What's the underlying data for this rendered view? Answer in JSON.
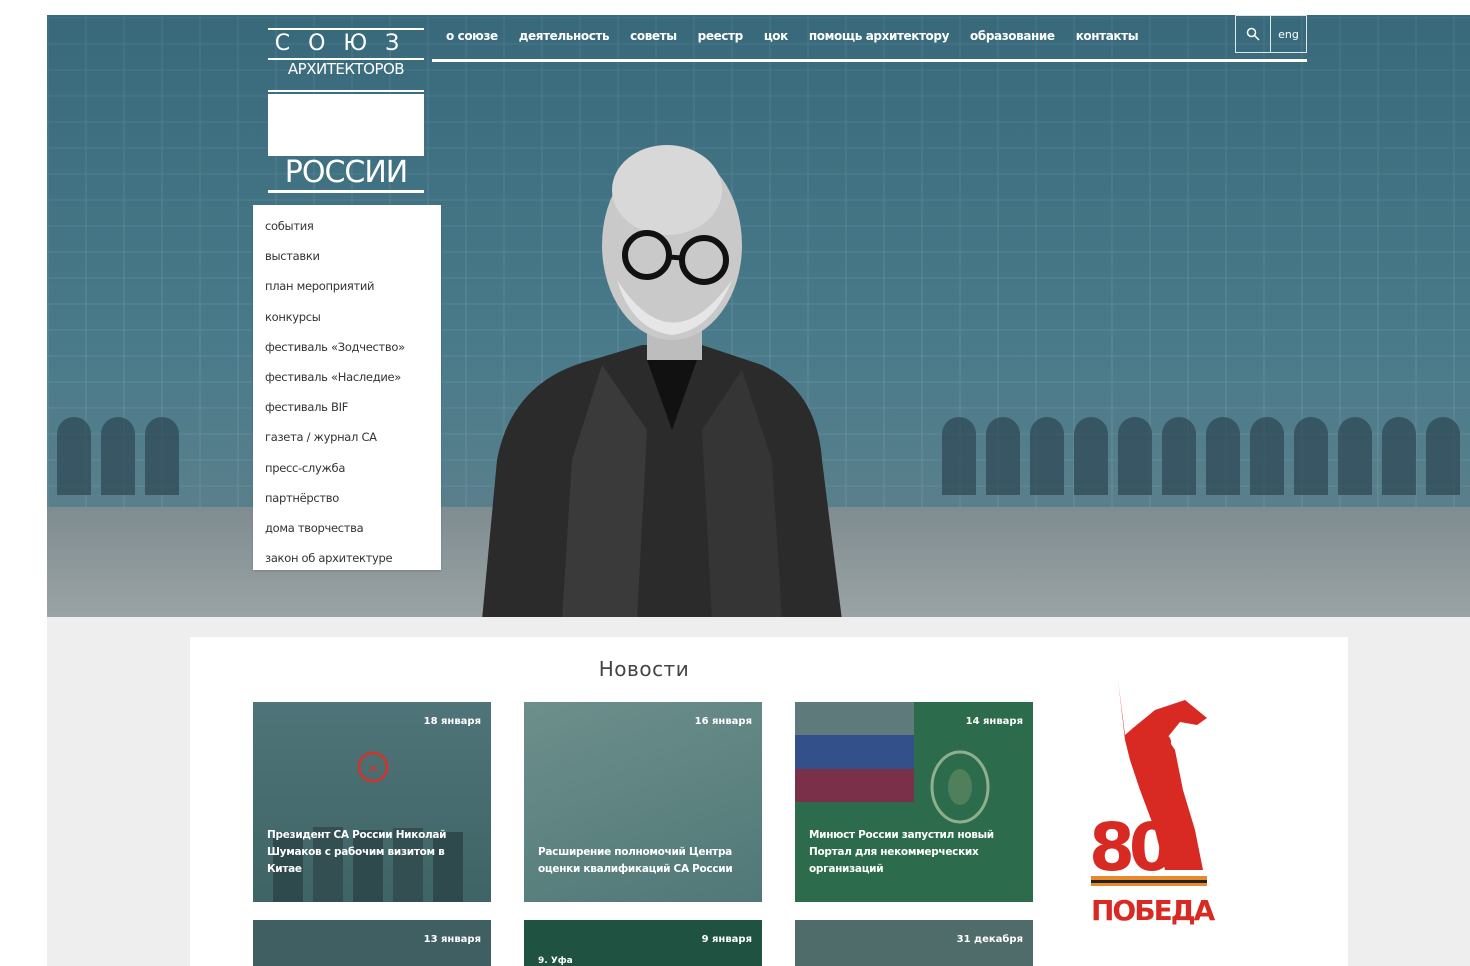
{
  "logo": {
    "line1": "СОЮЗ",
    "line2": "АРХИТЕКТОРОВ",
    "line3": "РОССИИ"
  },
  "topnav": {
    "items": [
      "о союзе",
      "деятельность",
      "советы",
      "реестр",
      "цок",
      "помощь архитектору",
      "образование",
      "контакты"
    ],
    "lang": "eng"
  },
  "dropdown": {
    "items": [
      "события",
      "выставки",
      "план мероприятий",
      "конкурсы",
      "фестиваль «Зодчество»",
      "фестиваль «Наследие»",
      "фестиваль BIF",
      "газета / журнал СА",
      "пресс-служба",
      "партнёрство",
      "дома творчества",
      "закон об архитектуре"
    ]
  },
  "news": {
    "title": "Новости",
    "cards": [
      {
        "date": "18 января",
        "title": "Президент СА России Николай Шумаков с рабочим визитом в Китае"
      },
      {
        "date": "16 января",
        "title": "Расширение полномочий Центра оценки квалификаций СА России"
      },
      {
        "date": "14 января",
        "title": "Минюст России запустил новый Портал для некоммерческих организаций"
      },
      {
        "date": "13 января",
        "title": ""
      },
      {
        "date": "9 января",
        "title": "9. Уфа"
      },
      {
        "date": "31 декабря",
        "title": ""
      }
    ]
  },
  "victory": {
    "number": "80",
    "word": "ПОБЕДА!"
  },
  "colors": {
    "hero_tint": "#4b7c8c",
    "victory_red": "#d82a23",
    "card_green": "#2c6b4c"
  }
}
